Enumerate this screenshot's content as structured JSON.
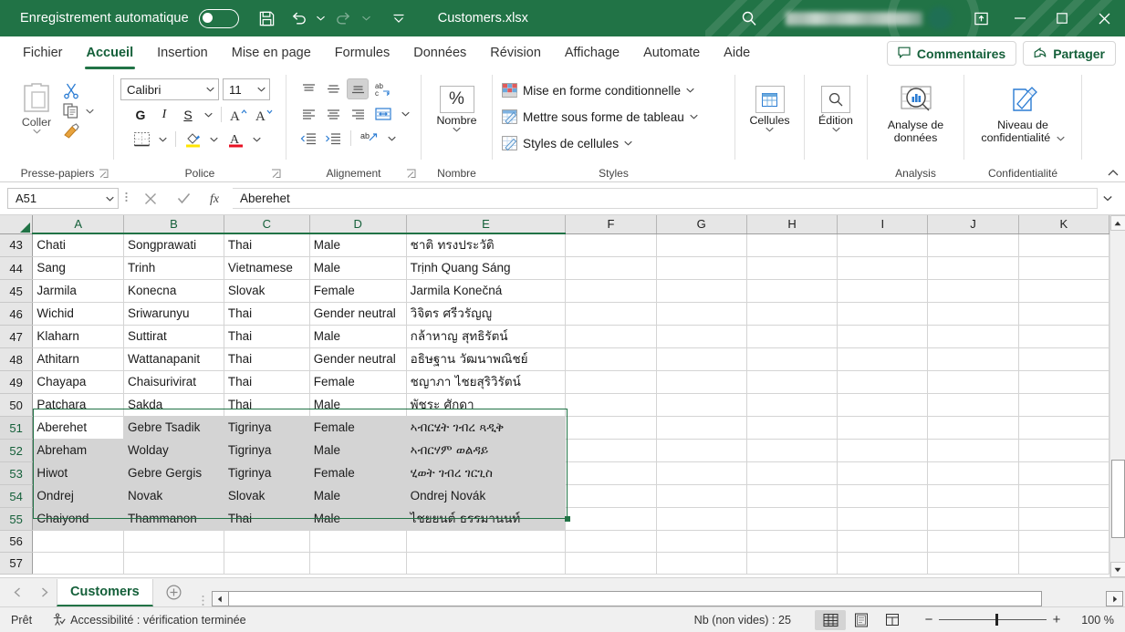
{
  "titlebar": {
    "autosave_label": "Enregistrement automatique",
    "autosave_state": "off",
    "document_title": "Customers.xlsx",
    "account_name": "",
    "brand_color": "#217346"
  },
  "ribbon_tabs": [
    {
      "label": "Fichier",
      "active": false
    },
    {
      "label": "Accueil",
      "active": true
    },
    {
      "label": "Insertion",
      "active": false
    },
    {
      "label": "Mise en page",
      "active": false
    },
    {
      "label": "Formules",
      "active": false
    },
    {
      "label": "Données",
      "active": false
    },
    {
      "label": "Révision",
      "active": false
    },
    {
      "label": "Affichage",
      "active": false
    },
    {
      "label": "Automate",
      "active": false
    },
    {
      "label": "Aide",
      "active": false
    }
  ],
  "tabs_right": {
    "comments_label": "Commentaires",
    "share_label": "Partager"
  },
  "ribbon": {
    "clipboard": {
      "group_label": "Presse-papiers",
      "paste_label": "Coller"
    },
    "font": {
      "group_label": "Police",
      "font_name": "Calibri",
      "font_size": "11",
      "bold_label": "G",
      "italic_label": "I",
      "underline_label": "S",
      "grow_label": "A",
      "shrink_label": "A"
    },
    "alignment": {
      "group_label": "Alignement"
    },
    "number": {
      "group_label": "Nombre",
      "button_label": "Nombre",
      "format_symbol": "%"
    },
    "styles": {
      "group_label": "Styles",
      "items": [
        "Mise en forme conditionnelle",
        "Mettre sous forme de tableau",
        "Styles de cellules"
      ]
    },
    "cells": {
      "group_label": "",
      "button_label": "Cellules"
    },
    "editing": {
      "button_label": "Édition"
    },
    "analysis": {
      "group_label": "Analysis",
      "button_label_line1": "Analyse de",
      "button_label_line2": "données"
    },
    "sensitivity": {
      "group_label": "Confidentialité",
      "button_label_line1": "Niveau de",
      "button_label_line2": "confidentialité"
    }
  },
  "formula_bar": {
    "name_box": "A51",
    "cancel_icon": "close-icon",
    "enter_icon": "check-icon",
    "function_icon": "fx-icon",
    "formula_value": "Aberehet"
  },
  "grid": {
    "columns": [
      "A",
      "B",
      "C",
      "D",
      "E",
      "F",
      "G",
      "H",
      "I",
      "J",
      "K"
    ],
    "selected_columns": [
      "A",
      "B",
      "C",
      "D",
      "E"
    ],
    "rows": [
      {
        "num": "43",
        "cells": [
          "Chati",
          "Songprawati",
          "Thai",
          "Male",
          "ชาติ ทรงประวัติ"
        ],
        "selected": false
      },
      {
        "num": "44",
        "cells": [
          "Sang",
          "Trinh",
          "Vietnamese",
          "Male",
          "Trịnh Quang Sáng"
        ],
        "selected": false
      },
      {
        "num": "45",
        "cells": [
          "Jarmila",
          "Konecna",
          "Slovak",
          "Female",
          "Jarmila Konečná"
        ],
        "selected": false
      },
      {
        "num": "46",
        "cells": [
          "Wichid",
          "Sriwarunyu",
          "Thai",
          "Gender neutral",
          "วิจิตร ศรีวรัญญู"
        ],
        "selected": false
      },
      {
        "num": "47",
        "cells": [
          "Klaharn",
          "Suttirat",
          "Thai",
          "Male",
          "กล้าหาญ สุทธิรัตน์"
        ],
        "selected": false
      },
      {
        "num": "48",
        "cells": [
          "Athitarn",
          "Wattanapanit",
          "Thai",
          "Gender neutral",
          "อธิษฐาน วัฒนาพณิชย์"
        ],
        "selected": false
      },
      {
        "num": "49",
        "cells": [
          "Chayapa",
          "Chaisurivirat",
          "Thai",
          "Female",
          "ชญาภา ไชยสุริวิรัตน์"
        ],
        "selected": false
      },
      {
        "num": "50",
        "cells": [
          "Patchara",
          "Sakda",
          "Thai",
          "Male",
          "พัชระ ศักดา"
        ],
        "selected": false
      },
      {
        "num": "51",
        "cells": [
          "Aberehet",
          "Gebre Tsadik",
          "Tigrinya",
          "Female",
          "ኣብርሄት ገብረ ጻዲቅ"
        ],
        "selected": true,
        "active": true
      },
      {
        "num": "52",
        "cells": [
          "Abreham",
          "Wolday",
          "Tigrinya",
          "Male",
          "ኣብርሃም ወልዳይ"
        ],
        "selected": true
      },
      {
        "num": "53",
        "cells": [
          "Hiwot",
          "Gebre Gergis",
          "Tigrinya",
          "Female",
          "ሂወት ገብረ ገርጊስ"
        ],
        "selected": true
      },
      {
        "num": "54",
        "cells": [
          "Ondrej",
          "Novak",
          "Slovak",
          "Male",
          "Ondrej Novák"
        ],
        "selected": true
      },
      {
        "num": "55",
        "cells": [
          "Chaiyond",
          "Thammanon",
          "Thai",
          "Male",
          "ไชยยนต์ ธรรมานนท์"
        ],
        "selected": true
      },
      {
        "num": "56",
        "cells": [
          "",
          "",
          "",
          "",
          ""
        ],
        "selected": false
      },
      {
        "num": "57",
        "cells": [
          "",
          "",
          "",
          "",
          ""
        ],
        "selected": false
      }
    ]
  },
  "sheet_tabs": {
    "tabs": [
      {
        "label": "Customers",
        "active": true
      }
    ],
    "add_label": "+"
  },
  "statusbar": {
    "mode": "Prêt",
    "accessibility": "Accessibilité : vérification terminée",
    "count_label": "Nb (non vides) : 25",
    "zoom_value": "100 %",
    "zoom_minus": "−",
    "zoom_plus": "+"
  }
}
